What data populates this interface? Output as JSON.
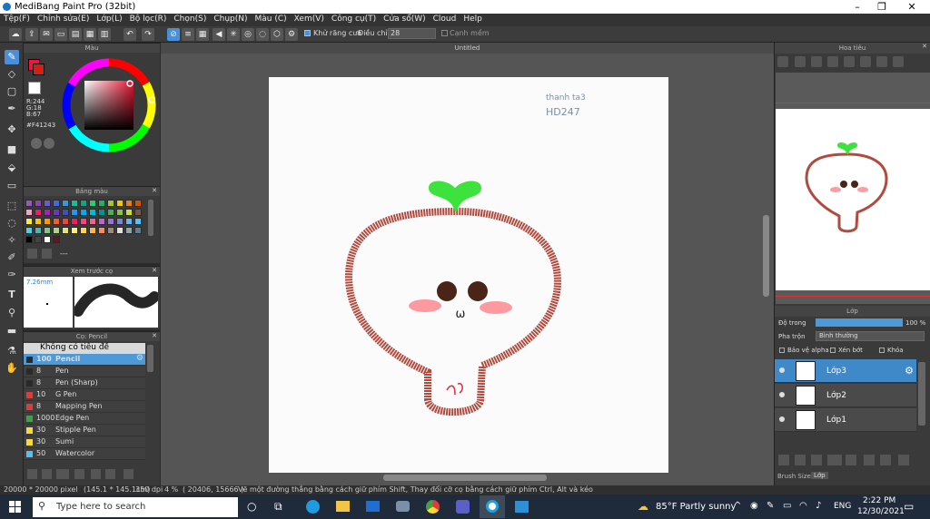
{
  "window": {
    "title": "MediBang Paint Pro (32bit)"
  },
  "menu": [
    "Tệp(F)",
    "Chỉnh sửa(E)",
    "Lớp(L)",
    "Bộ lọc(R)",
    "Chọn(S)",
    "Chụp(N)",
    "Màu (C)",
    "Xem(V)",
    "Công cụ(T)",
    "Cửa sổ(W)",
    "Cloud",
    "Help"
  ],
  "toolbar": {
    "antialias_label": "Khử răng cưa",
    "adjust_label": "Điều chỉnh",
    "adjust_value": "28",
    "soft_label": "Cạnh mềm"
  },
  "color_panel": {
    "title": "Màu",
    "r": "R:244",
    "g": "G:18",
    "b": "B:67",
    "hex": "#F41243",
    "main_color": "#f41243"
  },
  "palette_panel": {
    "title": "Bảng màu",
    "more": "---",
    "colors": [
      "#9b59b6",
      "#8e44ad",
      "#6a5acd",
      "#4169e1",
      "#3498db",
      "#1abc9c",
      "#16a085",
      "#2ecc71",
      "#27ae60",
      "#a3c639",
      "#f1c40f",
      "#e67e22",
      "#d35400",
      "#f4a4c0",
      "#e91e63",
      "#9c27b0",
      "#673ab7",
      "#3f51b5",
      "#2196f3",
      "#03a9f4",
      "#00bcd4",
      "#009688",
      "#4caf50",
      "#8bc34a",
      "#cddc39",
      "#795548",
      "#ffeb3b",
      "#ffc107",
      "#ff9800",
      "#ff5722",
      "#f44336",
      "#e91e63",
      "#ff4081",
      "#f06292",
      "#ba68c8",
      "#9575cd",
      "#7986cb",
      "#64b5f6",
      "#4fc3f7",
      "#4dd0e1",
      "#4db6ac",
      "#81c784",
      "#aed581",
      "#dce775",
      "#fff176",
      "#ffd54f",
      "#ffb74d",
      "#ff8a65",
      "#a1887f",
      "#e0e0e0",
      "#90a4ae",
      "#607d8b",
      "#000000",
      "#444444",
      "#ffffff",
      "#5c1a1a"
    ]
  },
  "preview_panel": {
    "title": "Xem trước cọ",
    "size": "7.26mm"
  },
  "brush_panel": {
    "title": "Cọ: Pencil",
    "group": "Không có tiêu đề",
    "brushes": [
      {
        "size": "100",
        "name": "Pencil",
        "color": "#2a2a2a",
        "selected": true
      },
      {
        "size": "8",
        "name": "Pen",
        "color": "#2a2a2a"
      },
      {
        "size": "8",
        "name": "Pen (Sharp)",
        "color": "#2a2a2a"
      },
      {
        "size": "10",
        "name": "G Pen",
        "color": "#e53935"
      },
      {
        "size": "8",
        "name": "Mapping Pen",
        "color": "#e53935"
      },
      {
        "size": "1000",
        "name": "Edge Pen",
        "color": "#43a047"
      },
      {
        "size": "30",
        "name": "Stipple Pen",
        "color": "#fdd835"
      },
      {
        "size": "30",
        "name": "Sumi",
        "color": "#fdd835"
      },
      {
        "size": "50",
        "name": "Watercolor",
        "color": "#4fc3f7"
      }
    ]
  },
  "canvas": {
    "tab_title": "Untitled",
    "signature_line1": "thanh ta3",
    "signature_line2": "HD247",
    "mouth_mark": "ω"
  },
  "navigator": {
    "title": "Hoa tiêu"
  },
  "layer_panel": {
    "title": "Lớp",
    "opacity_label": "Độ trong",
    "opacity_value": "100 %",
    "opacity": 1.0,
    "blend_label": "Pha trộn",
    "blend_value": "Bình thường",
    "protect_alpha": "Bảo vệ alpha",
    "clipping": "Xén bớt",
    "lock": "Khóa",
    "layers": [
      {
        "name": "Lớp3",
        "selected": true
      },
      {
        "name": "Lớp2"
      },
      {
        "name": "Lớp1"
      }
    ],
    "tab_brush_size": "Brush Size",
    "tab_layer": "Lớp"
  },
  "status": {
    "size": "20000 * 20000 pixel",
    "cm": "(145.1 * 145.1cm)",
    "dpi": "350 dpi",
    "zoom": "4 %",
    "coords": "( 20406, 15666 )",
    "hint": "Vẽ một đường thẳng bằng cách giữ phím Shift, Thay đổi cỡ cọ bằng cách giữ phím Ctrl, Alt và kéo"
  },
  "taskbar": {
    "search": "Type here to search",
    "weather": "85°F  Partly sunny",
    "lang": "ENG",
    "time": "2:22 PM",
    "date": "12/30/2021"
  }
}
